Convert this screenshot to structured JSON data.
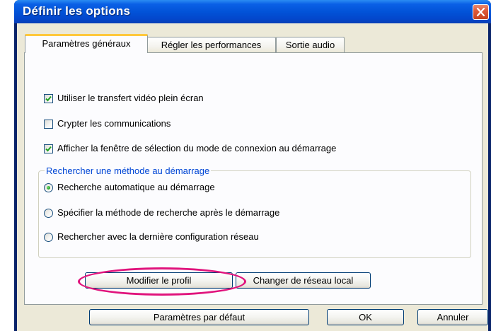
{
  "window": {
    "title": "Définir les options",
    "colors": {
      "title_bar": "#0253d8",
      "close_button": "#de5a3a",
      "highlight": "#e0137c",
      "group_label": "#0046d5"
    }
  },
  "tabs": [
    {
      "label": "Paramètres généraux",
      "active": true
    },
    {
      "label": "Régler les performances",
      "active": false
    },
    {
      "label": "Sortie audio",
      "active": false
    }
  ],
  "options": {
    "fullscreen": {
      "label": "Utiliser le transfert vidéo plein écran",
      "checked": true
    },
    "encrypt": {
      "label": "Crypter les communications",
      "checked": false
    },
    "show_connection": {
      "label": "Afficher la fenêtre de sélection du mode de connexion au démarrage",
      "checked": true
    }
  },
  "search_group": {
    "title": "Rechercher une méthode au démarrage",
    "radios": [
      {
        "label": "Recherche automatique au démarrage",
        "selected": true
      },
      {
        "label": "Spécifier la méthode de recherche après le démarrage",
        "selected": false
      },
      {
        "label": "Rechercher avec la dernière configuration réseau",
        "selected": false
      }
    ]
  },
  "buttons": {
    "modify_profile": "Modifier le profil",
    "change_network": "Changer de réseau local",
    "defaults": "Paramètres par défaut",
    "ok": "OK",
    "cancel": "Annuler"
  },
  "icons": {
    "close": "close-x-icon",
    "check": "checkmark-icon"
  }
}
